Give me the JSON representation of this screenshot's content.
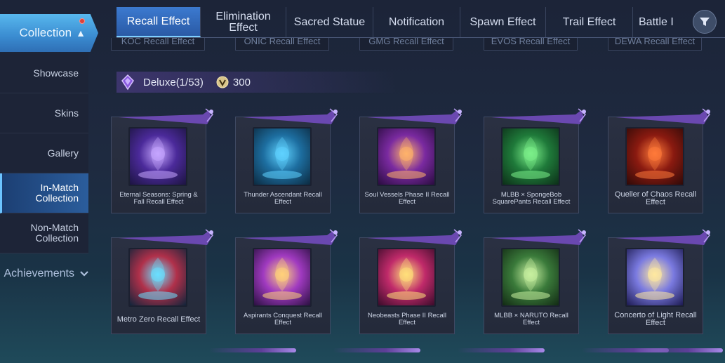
{
  "sidebar": {
    "collection_label": "Collection",
    "items": [
      {
        "label": "Showcase"
      },
      {
        "label": "Skins"
      },
      {
        "label": "Gallery"
      },
      {
        "label": "In-Match Collection"
      },
      {
        "label": "Non-Match Collection"
      }
    ],
    "achievements_label": "Achievements"
  },
  "tabs": [
    {
      "label": "Recall Effect",
      "active": true
    },
    {
      "label": "Elimination Effect"
    },
    {
      "label": "Sacred Statue"
    },
    {
      "label": "Notification"
    },
    {
      "label": "Spawn Effect"
    },
    {
      "label": "Trail Effect"
    },
    {
      "label": "Battle I"
    }
  ],
  "partial_row": [
    "KOC Recall Effect",
    "ONIC Recall Effect",
    "GMG Recall Effect",
    "EVOS Recall Effect",
    "DEWA Recall Effect"
  ],
  "section": {
    "title": "Deluxe(1/53)",
    "count": "300"
  },
  "cards": [
    {
      "name": "Eternal Seasons: Spring & Fall Recall Effect",
      "colors": [
        "#c6a6ff",
        "#4b2a9a",
        "#1c1440"
      ]
    },
    {
      "name": "Thunder Ascendant Recall Effect",
      "colors": [
        "#5fd2ff",
        "#1d6ea0",
        "#0c2a40"
      ]
    },
    {
      "name": "Soul Vessels Phase II Recall Effect",
      "colors": [
        "#ffb36a",
        "#7a2aa0",
        "#2a0c40"
      ]
    },
    {
      "name": "MLBB × SpongeBob SquarePants Recall Effect",
      "colors": [
        "#7cf08a",
        "#1f7a3a",
        "#0c2e18"
      ]
    },
    {
      "name": "Queller of Chaos Recall Effect",
      "colors": [
        "#ff7a3a",
        "#8a1a10",
        "#2e0a08"
      ]
    },
    {
      "name": "Metro Zero Recall Effect",
      "colors": [
        "#6ae0ff",
        "#b0304a",
        "#10243a"
      ]
    },
    {
      "name": "Aspirants Conquest Recall Effect",
      "colors": [
        "#ffd27a",
        "#a03ac0",
        "#2a1040"
      ]
    },
    {
      "name": "Neobeasts Phase II Recall Effect",
      "colors": [
        "#ffe07a",
        "#c02a6a",
        "#3a0c2a"
      ]
    },
    {
      "name": "MLBB × NARUTO Recall Effect",
      "colors": [
        "#c8f0a0",
        "#3a7a3a",
        "#122a14"
      ]
    },
    {
      "name": "Concerto of Light Recall Effect",
      "colors": [
        "#ffe9a0",
        "#7a7ae0",
        "#1c1a50"
      ]
    }
  ]
}
